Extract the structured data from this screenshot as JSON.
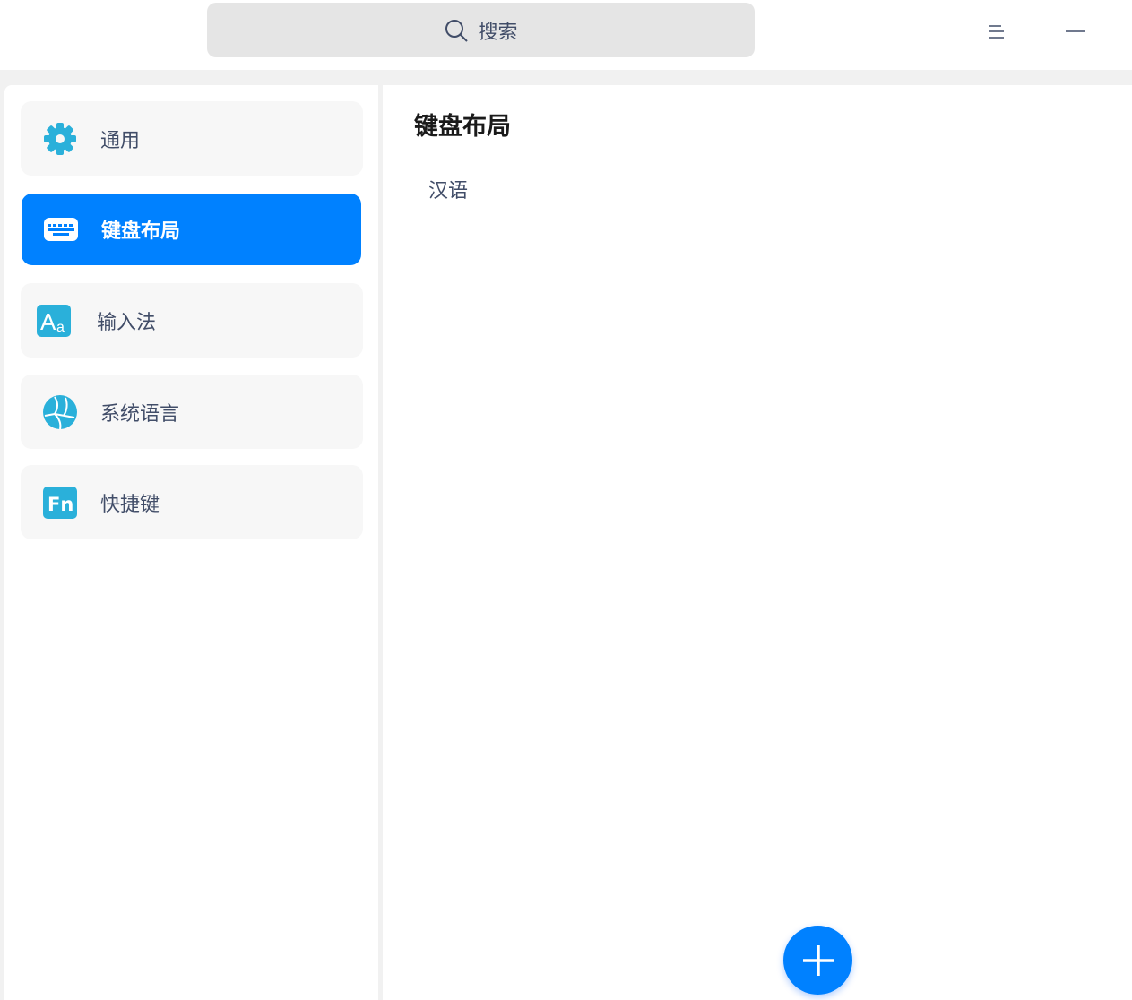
{
  "search": {
    "placeholder": "搜索"
  },
  "sidebar": {
    "items": [
      {
        "label": "通用",
        "icon": "gear-icon"
      },
      {
        "label": "键盘布局",
        "icon": "keyboard-icon",
        "active": true
      },
      {
        "label": "输入法",
        "icon": "input-method-icon"
      },
      {
        "label": "系统语言",
        "icon": "globe-icon"
      },
      {
        "label": "快捷键",
        "icon": "fn-key-icon"
      }
    ]
  },
  "content": {
    "title": "键盘布局",
    "layouts": [
      "汉语"
    ]
  },
  "colors": {
    "accent": "#0081ff",
    "icon": "#2ab0da",
    "text": "#414d68"
  }
}
